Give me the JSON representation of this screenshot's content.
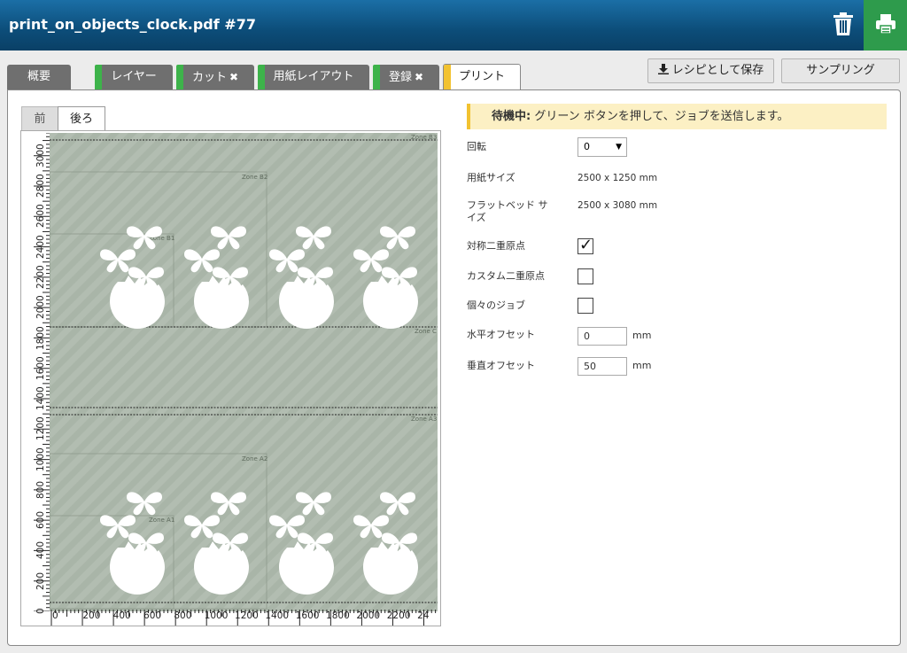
{
  "header": {
    "title": "print_on_objects_clock.pdf #77",
    "delete_icon": "trash-icon",
    "print_icon": "printer-icon"
  },
  "tabs": {
    "overview": "概要",
    "layer": "レイヤー",
    "cut": "カット",
    "media_layout": "用紙レイアウト",
    "register": "登録",
    "print": "プリント",
    "close_glyph": "✖"
  },
  "actions": {
    "save_recipe": "レシピとして保存",
    "sampling": "サンプリング",
    "download_icon": "download-icon"
  },
  "side_tabs": {
    "front": "前",
    "back": "後ろ"
  },
  "preview": {
    "zones": [
      "Zone B3",
      "Zone B2",
      "Zone B1",
      "Zone C",
      "Zone A3",
      "Zone A2",
      "Zone A1"
    ],
    "y_ticks": [
      "0",
      "200",
      "400",
      "600",
      "800",
      "1000",
      "1200",
      "1400",
      "1600",
      "1800",
      "2000",
      "2200",
      "2400",
      "2600",
      "2800",
      "3000"
    ],
    "x_ticks": [
      "0",
      "200",
      "400",
      "600",
      "800",
      "1000",
      "1200",
      "1400",
      "1600",
      "1800",
      "2000",
      "2200",
      "24"
    ],
    "background_color": "#a9b5a8"
  },
  "status": {
    "label": "待機中:",
    "message": " グリーン ボタンを押して、ジョブを送信します。"
  },
  "settings": {
    "rotation_label": "回転",
    "rotation_value": "0",
    "media_size_label": "用紙サイズ",
    "media_size_value": "2500 x 1250 mm",
    "flatbed_size_label": "フラットベッド サイズ",
    "flatbed_size_value": "2500 x 3080 mm",
    "symmetric_origin_label": "対称二重原点",
    "symmetric_origin_checked": true,
    "custom_origin_label": "カスタム二重原点",
    "custom_origin_checked": false,
    "individual_jobs_label": "個々のジョブ",
    "individual_jobs_checked": false,
    "h_offset_label": "水平オフセット",
    "h_offset_value": "0",
    "v_offset_label": "垂直オフセット",
    "v_offset_value": "50",
    "unit": "mm",
    "check_glyph": "✓"
  }
}
